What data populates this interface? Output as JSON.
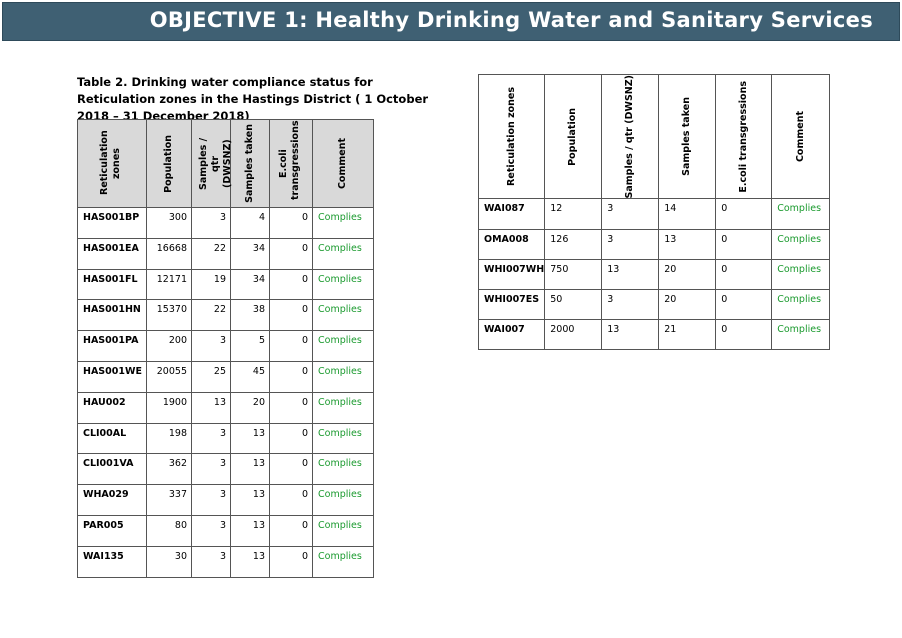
{
  "banner": {
    "title": "OBJECTIVE 1: Healthy Drinking Water and Sanitary Services"
  },
  "table1": {
    "caption": "Table 2. Drinking water compliance status for Reticulation zones in the Hastings District ( 1 October 2018 – 31 December 2018)",
    "headers": [
      "Reticulation zones",
      "Population",
      "Samples / qtr (DWSNZ)",
      "Samples taken",
      "E.coli transgressions",
      "Comment"
    ],
    "rows": [
      [
        "HAS001BP",
        "300",
        "3",
        "4",
        "0",
        "Complies"
      ],
      [
        "HAS001EA",
        "16668",
        "22",
        "34",
        "0",
        "Complies"
      ],
      [
        "HAS001FL",
        "12171",
        "19",
        "34",
        "0",
        "Complies"
      ],
      [
        "HAS001HN",
        "15370",
        "22",
        "38",
        "0",
        "Complies"
      ],
      [
        "HAS001PA",
        "200",
        "3",
        "5",
        "0",
        "Complies"
      ],
      [
        "HAS001WE",
        "20055",
        "25",
        "45",
        "0",
        "Complies"
      ],
      [
        "HAU002",
        "1900",
        "13",
        "20",
        "0",
        "Complies"
      ],
      [
        "CLI00AL",
        "198",
        "3",
        "13",
        "0",
        "Complies"
      ],
      [
        "CLI001VA",
        "362",
        "3",
        "13",
        "0",
        "Complies"
      ],
      [
        "WHA029",
        "337",
        "3",
        "13",
        "0",
        "Complies"
      ],
      [
        "PAR005",
        "80",
        "3",
        "13",
        "0",
        "Complies"
      ],
      [
        "WAI135",
        "30",
        "3",
        "13",
        "0",
        "Complies"
      ]
    ]
  },
  "table2": {
    "headers": [
      "Reticulation zones",
      "Population",
      "Samples / qtr (DWSNZ)",
      "Samples taken",
      "E.coli transgressions",
      "Comment"
    ],
    "rows": [
      [
        "WAI087",
        "12",
        "3",
        "14",
        "0",
        "Complies"
      ],
      [
        "OMA008",
        "126",
        "3",
        "13",
        "0",
        "Complies"
      ],
      [
        "WHI007WH",
        "750",
        "13",
        "20",
        "0",
        "Complies"
      ],
      [
        "WHI007ES",
        "50",
        "3",
        "20",
        "0",
        "Complies"
      ],
      [
        "WAI007",
        "2000",
        "13",
        "21",
        "0",
        "Complies"
      ]
    ]
  }
}
